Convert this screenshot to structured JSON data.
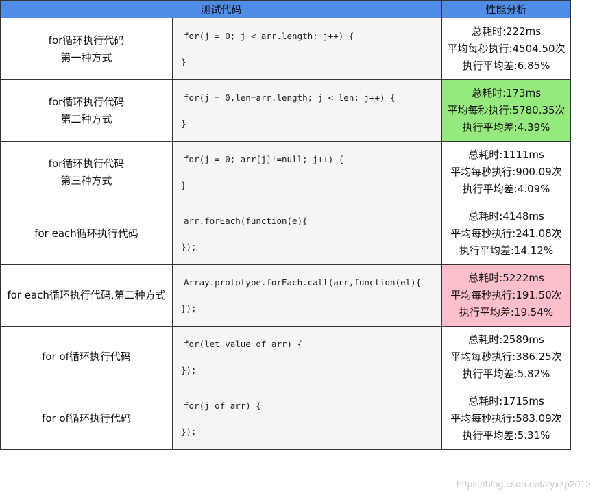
{
  "header": {
    "code_col": "测试代码",
    "perf_col": "性能分析"
  },
  "colors": {
    "header_bg": "#4f8de8",
    "best_bg": "#96ea7d",
    "worst_bg": "#fdbfcb"
  },
  "rows": [
    {
      "name1": "for循环执行代码",
      "name2": "第一种方式",
      "code1": "for(j = 0; j < arr.length; j++) {",
      "code2": "}",
      "perf1": "总耗时:222ms",
      "perf2": "平均每秒执行:4504.50次",
      "perf3": "执行平均差:6.85%"
    },
    {
      "name1": "for循环执行代码",
      "name2": "第二种方式",
      "code1": "for(j = 0,len=arr.length; j < len; j++) {",
      "code2": "}",
      "perf1": "总耗时:173ms",
      "perf2": "平均每秒执行:5780.35次",
      "perf3": "执行平均差:4.39%"
    },
    {
      "name1": "for循环执行代码",
      "name2": "第三种方式",
      "code1": "for(j = 0; arr[j]!=null; j++) {",
      "code2": "}",
      "perf1": "总耗时:1111ms",
      "perf2": "平均每秒执行:900.09次",
      "perf3": "执行平均差:4.09%"
    },
    {
      "name1": "for each循环执行代码",
      "name2": "",
      "code1": "arr.forEach(function(e){",
      "code2": "});",
      "perf1": "总耗时:4148ms",
      "perf2": "平均每秒执行:241.08次",
      "perf3": "执行平均差:14.12%"
    },
    {
      "name1": "for each循环执行代码,第二种方式",
      "name2": "",
      "code1": "Array.prototype.forEach.call(arr,function(el){",
      "code2": "});",
      "perf1": "总耗时:5222ms",
      "perf2": "平均每秒执行:191.50次",
      "perf3": "执行平均差:19.54%"
    },
    {
      "name1": "for of循环执行代码",
      "name2": "",
      "code1": "for(let value of arr) {",
      "code2": "});",
      "perf1": "总耗时:2589ms",
      "perf2": "平均每秒执行:386.25次",
      "perf3": "执行平均差:5.82%"
    },
    {
      "name1": "for of循环执行代码",
      "name2": "",
      "code1": "for(j of arr) {",
      "code2": "});",
      "perf1": "总耗时:1715ms",
      "perf2": "平均每秒执行:583.09次",
      "perf3": "执行平均差:5.31%"
    }
  ],
  "watermark": "https://blog.csdn.net/zyxzp2012"
}
